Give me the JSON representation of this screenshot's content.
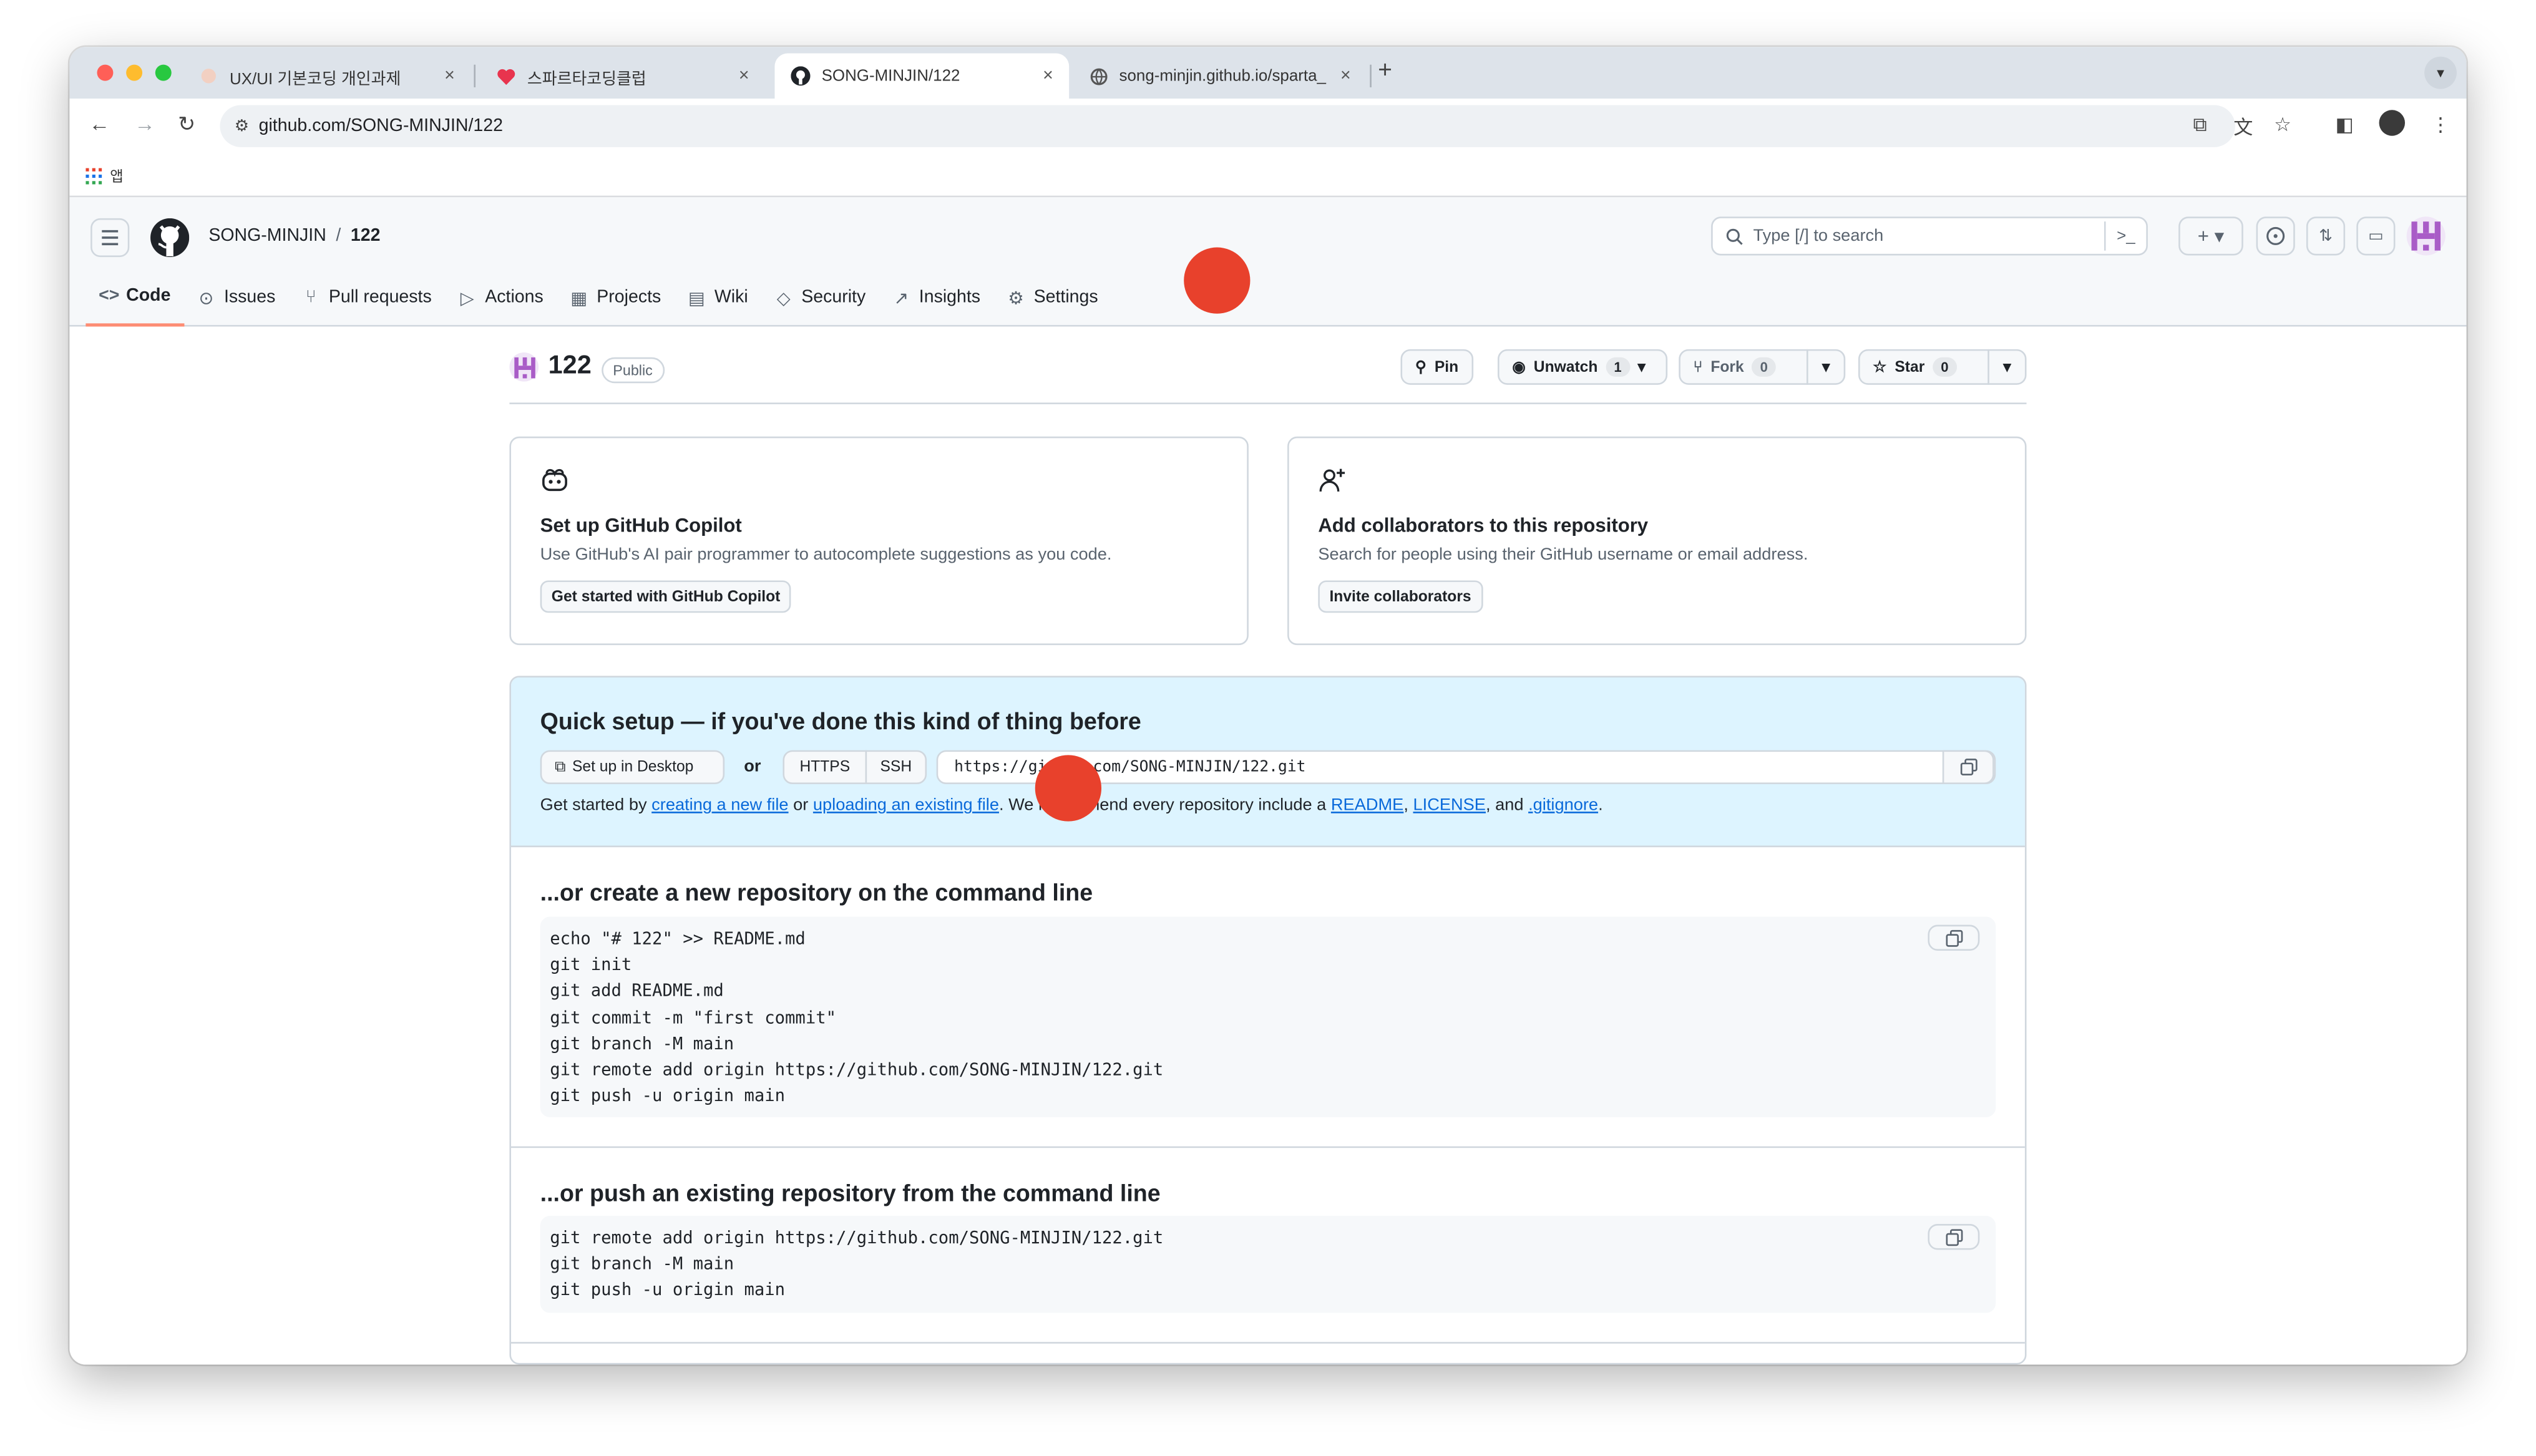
{
  "browser": {
    "tabs": [
      {
        "title": "UX/UI 기본코딩 개인과제",
        "close": "×"
      },
      {
        "title": "스파르타코딩클럽",
        "close": "×"
      },
      {
        "title": "SONG-MINJIN/122",
        "close": "×"
      },
      {
        "title": "song-minjin.github.io/sparta_",
        "close": "×"
      }
    ],
    "new_tab": "+",
    "url": "github.com/SONG-MINJIN/122",
    "bookmarks_label": "앱"
  },
  "github": {
    "owner": "SONG-MINJIN",
    "separator": "/",
    "repo": "122",
    "search_placeholder": "Type [/] to search",
    "nav": [
      {
        "label": "Code",
        "icon": "code-icon"
      },
      {
        "label": "Issues",
        "icon": "issue-icon"
      },
      {
        "label": "Pull requests",
        "icon": "pull-request-icon"
      },
      {
        "label": "Actions",
        "icon": "play-icon"
      },
      {
        "label": "Projects",
        "icon": "table-icon"
      },
      {
        "label": "Wiki",
        "icon": "book-icon"
      },
      {
        "label": "Security",
        "icon": "shield-icon"
      },
      {
        "label": "Insights",
        "icon": "graph-icon"
      },
      {
        "label": "Settings",
        "icon": "gear-icon"
      }
    ]
  },
  "repo": {
    "name": "122",
    "visibility": "Public",
    "pin": "Pin",
    "unwatch": "Unwatch",
    "watch_count": "1",
    "fork": "Fork",
    "fork_count": "0",
    "star": "Star",
    "star_count": "0"
  },
  "cards": {
    "copilot": {
      "title": "Set up GitHub Copilot",
      "desc": "Use GitHub's AI pair programmer to autocomplete suggestions as you code.",
      "button": "Get started with GitHub Copilot"
    },
    "collab": {
      "title": "Add collaborators to this repository",
      "desc": "Search for people using their GitHub username or email address.",
      "button": "Invite collaborators"
    }
  },
  "quick_setup": {
    "title": "Quick setup — if you've done this kind of thing before",
    "desktop": "Set up in Desktop",
    "or": "or",
    "https": "HTTPS",
    "ssh": "SSH",
    "clone_url": "https://github.com/SONG-MINJIN/122.git",
    "hint_start": "Get started by",
    "link_new": "creating a new file",
    "hint_or": "or",
    "link_upload": "uploading an existing file",
    "hint_mid": ". We recommend every repository include a",
    "link_readme": "README",
    "link_license": "LICENSE",
    "hint_and": ", and",
    "link_gitignore": ".gitignore"
  },
  "new_repo": {
    "title": "...or create a new repository on the command line",
    "lines": [
      "echo \"# 122\" >> README.md",
      "git init",
      "git add README.md",
      "git commit -m \"first commit\"",
      "git branch -M main",
      "git remote add origin https://github.com/SONG-MINJIN/122.git",
      "git push -u origin main"
    ]
  },
  "push_repo": {
    "title": "...or push an existing repository from the command line",
    "lines": [
      "git remote add origin https://github.com/SONG-MINJIN/122.git",
      "git branch -M main",
      "git push -u origin main"
    ]
  },
  "colors": {
    "accent_link": "#0969da",
    "marker": "#e8412c",
    "nav_underline": "#fd8c73",
    "quick_bg": "#ddf4ff"
  }
}
